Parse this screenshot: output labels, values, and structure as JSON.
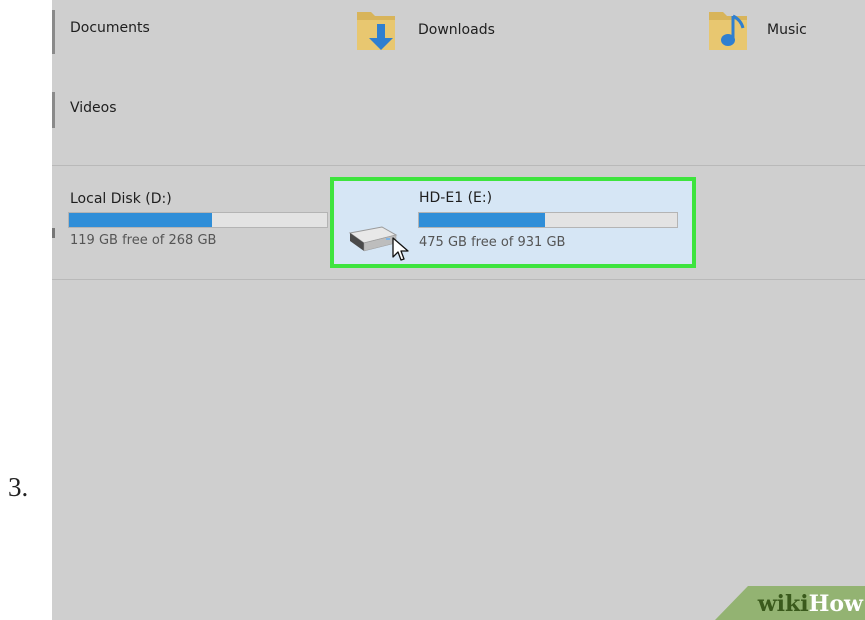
{
  "step": {
    "number": "3."
  },
  "folders": [
    {
      "label": "Documents",
      "icon": "documents-folder-icon"
    },
    {
      "label": "Downloads",
      "icon": "downloads-folder-icon"
    },
    {
      "label": "Music",
      "icon": "music-folder-icon"
    },
    {
      "label": "Videos",
      "icon": "videos-folder-icon"
    }
  ],
  "drives": [
    {
      "name": "Local Disk (D:)",
      "free_text": "119 GB free of 268 GB",
      "used_fraction": 0.556,
      "selected": false
    },
    {
      "name": "HD-E1 (E:)",
      "free_text": "475 GB free of 931 GB",
      "used_fraction": 0.49,
      "selected": true
    }
  ],
  "watermark": {
    "part1": "wiki",
    "part2": "How"
  },
  "colors": {
    "usage_bar": "#2f8ed8",
    "highlight_border": "#3ee43e",
    "selected_background": "#d6e6f5",
    "explorer_background": "#cfcfcf"
  }
}
